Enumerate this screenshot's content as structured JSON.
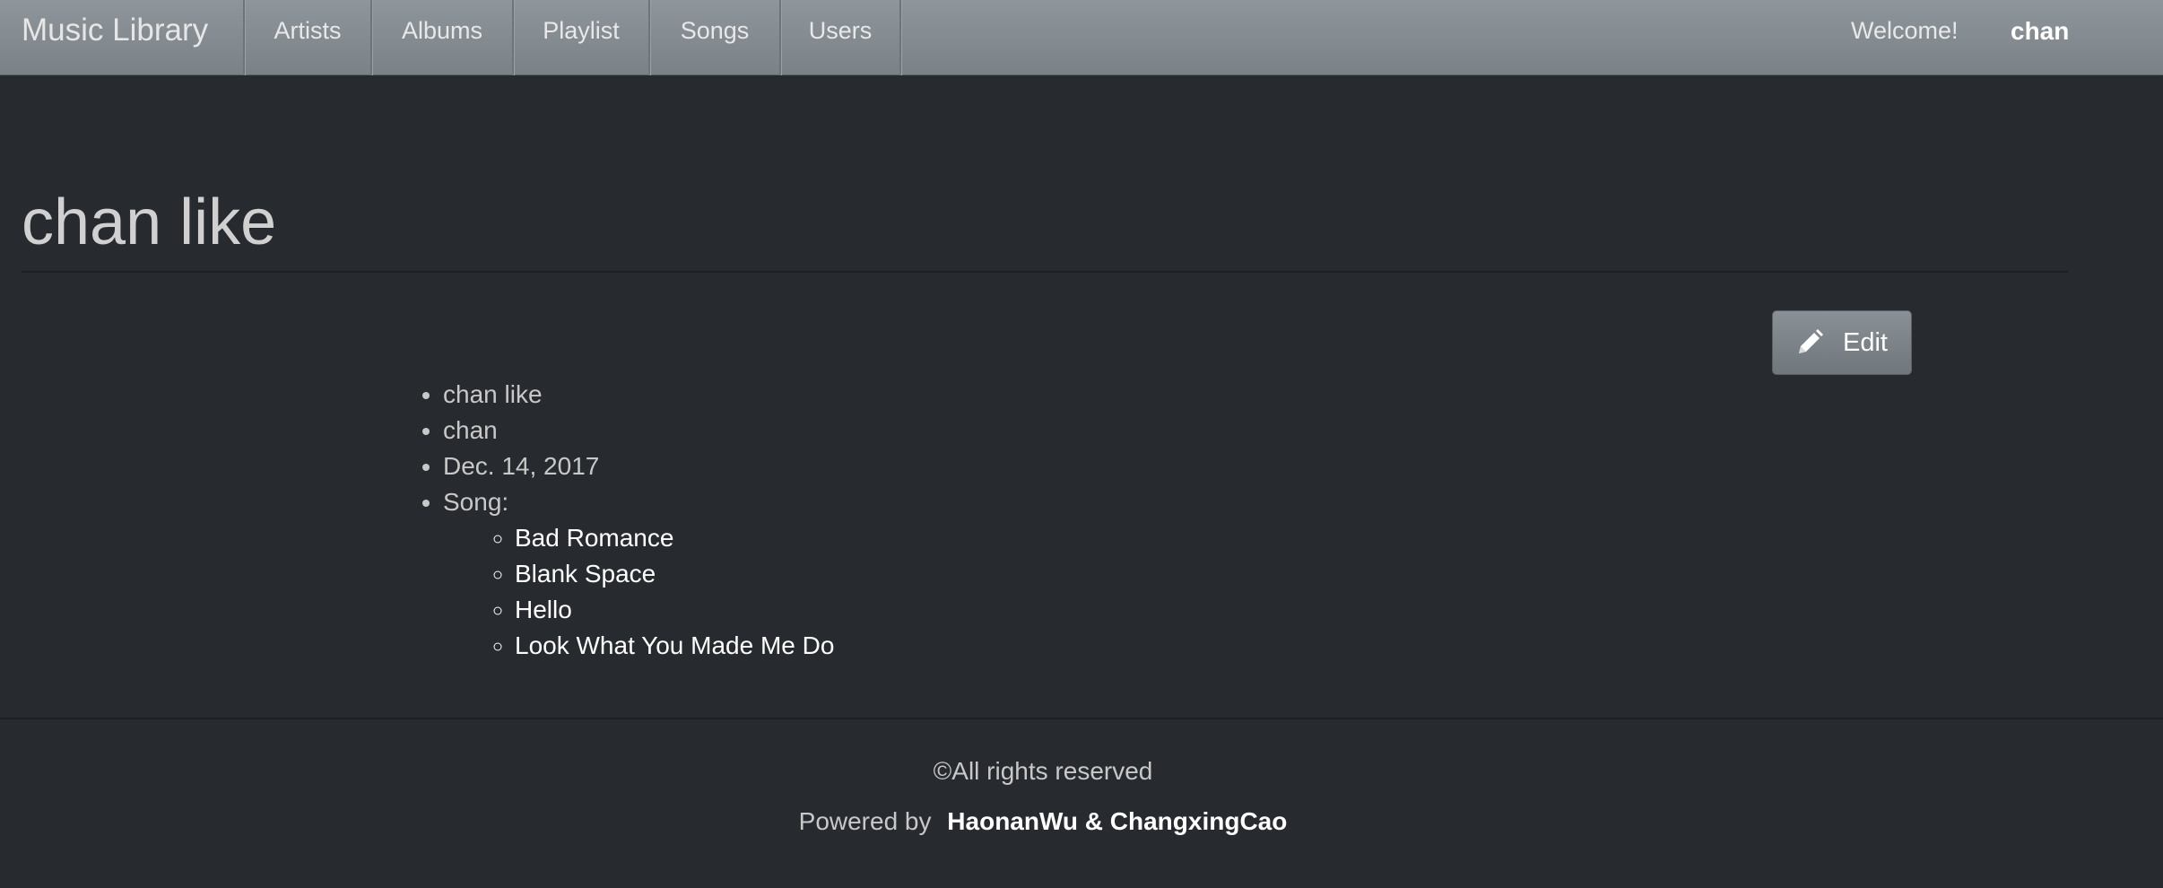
{
  "navbar": {
    "brand": "Music Library",
    "links": [
      "Artists",
      "Albums",
      "Playlist",
      "Songs",
      "Users"
    ],
    "welcome": "Welcome!",
    "username": "chan"
  },
  "page": {
    "title": "chan like",
    "edit_label": "Edit"
  },
  "details": {
    "name": "chan like",
    "owner": "chan",
    "date": "Dec. 14, 2017",
    "songs_label": "Song:",
    "songs": [
      "Bad Romance",
      "Blank Space",
      "Hello",
      "Look What You Made Me Do"
    ]
  },
  "footer": {
    "copyright": "©All rights reserved",
    "powered_by": "Powered by",
    "authors": "HaonanWu & ChangxingCao"
  },
  "colors": {
    "background": "#272a2f",
    "navbar": "#858c91",
    "text": "#c8c8c8",
    "link": "#ffffff"
  }
}
